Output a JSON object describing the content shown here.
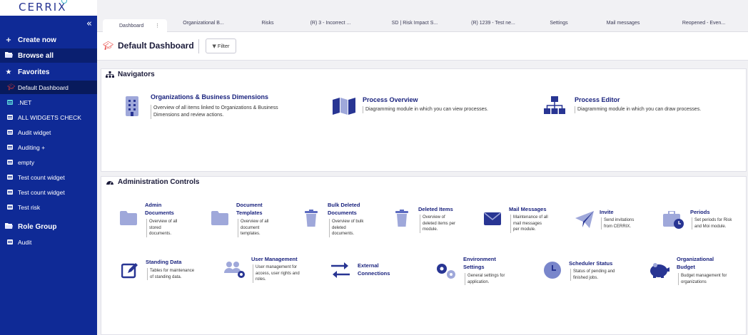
{
  "app": {
    "logo": "CERRIX"
  },
  "sidebar": {
    "collapse_icon": "double-chevron-left-icon",
    "create_now": "Create now",
    "browse_all": "Browse all",
    "favorites": "Favorites",
    "items": [
      {
        "label": "Default Dashboard",
        "icon": "dashboard-icon"
      },
      {
        "label": ".NET",
        "icon": "widget-icon"
      },
      {
        "label": "ALL WIDGETS CHECK",
        "icon": "widget-icon"
      },
      {
        "label": "Audit widget",
        "icon": "widget-icon"
      },
      {
        "label": "Auditing +",
        "icon": "widget-icon"
      },
      {
        "label": "empty",
        "icon": "widget-icon"
      },
      {
        "label": "Test count widget",
        "icon": "widget-icon"
      },
      {
        "label": "Test count widget",
        "icon": "widget-icon"
      },
      {
        "label": "Test risk",
        "icon": "widget-icon"
      }
    ],
    "role_group": "Role Group",
    "role_items": [
      {
        "label": "Audit",
        "icon": "widget-icon"
      }
    ]
  },
  "tabs": [
    {
      "label": "Dashboard"
    },
    {
      "label": "Organizational B..."
    },
    {
      "label": "Risks"
    },
    {
      "label": "(R) 3 - Incorrect ..."
    },
    {
      "label": "SD | Risk Impact S..."
    },
    {
      "label": "(R) 1239 - Test ne..."
    },
    {
      "label": "Settings"
    },
    {
      "label": "Mail messages"
    },
    {
      "label": "Reopened - Even..."
    }
  ],
  "page": {
    "title": "Default Dashboard",
    "filter_label": "Filter"
  },
  "navigators": {
    "title": "Navigators",
    "tiles": [
      {
        "title": "Organizations & Business Dimensions",
        "desc": [
          "Overview of all items linked to Organizations & Business",
          "Dimensions and review actions."
        ],
        "icon": "building-icon"
      },
      {
        "title": "Process Overview",
        "desc": [
          "Diagramming module in which you can view processes."
        ],
        "icon": "map-icon"
      },
      {
        "title": "Process Editor",
        "desc": [
          "Diagramming module in which you can draw processes."
        ],
        "icon": "sitemap-icon"
      }
    ]
  },
  "admin": {
    "title": "Administration Controls",
    "tiles": [
      {
        "title": [
          "Admin",
          "Documents"
        ],
        "desc": [
          "Overview of all",
          "stored",
          "documents."
        ],
        "icon": "folder-icon"
      },
      {
        "title": [
          "Document",
          "Templates"
        ],
        "desc": [
          "Overview of all",
          "document",
          "templates."
        ],
        "icon": "folder-icon"
      },
      {
        "title": [
          "Bulk Deleted",
          "Documents"
        ],
        "desc": [
          "Overview of bulk",
          "deleted",
          "documents."
        ],
        "icon": "trash-icon"
      },
      {
        "title": [
          "Deleted Items"
        ],
        "desc": [
          "Overview of",
          "deleted items per",
          "module."
        ],
        "icon": "trash-icon"
      },
      {
        "title": [
          "Mail Messages"
        ],
        "desc": [
          "Maintenance of all",
          "mail messages",
          "per module."
        ],
        "icon": "envelope-icon"
      },
      {
        "title": [
          "Invite"
        ],
        "desc": [
          "Send invitations",
          "from CERRIX."
        ],
        "icon": "paper-plane-icon"
      },
      {
        "title": [
          "Periods"
        ],
        "desc": [
          "Set periods for Risk",
          "and Moi module."
        ],
        "icon": "briefcase-clock-icon"
      },
      {
        "title": [
          "Standing Data"
        ],
        "desc": [
          "Tables for maintenance",
          "of standing data."
        ],
        "icon": "edit-icon"
      },
      {
        "title": [
          "User Management"
        ],
        "desc": [
          "User management for",
          "access, user rights and",
          "roles."
        ],
        "icon": "users-cog-icon"
      },
      {
        "title": [
          "External",
          "Connections"
        ],
        "desc": [],
        "icon": "exchange-icon"
      },
      {
        "title": [
          "Environment",
          "Settings"
        ],
        "desc": [
          "General settings for",
          "application."
        ],
        "icon": "cogs-icon"
      },
      {
        "title": [
          "Scheduler Status"
        ],
        "desc": [
          "Status of pending and",
          "finished jobs."
        ],
        "icon": "clock-icon"
      },
      {
        "title": [
          "Organizational",
          "Budget"
        ],
        "desc": [
          "Budget management for",
          "organizations"
        ],
        "icon": "piggy-bank-icon"
      }
    ]
  },
  "colors": {
    "sidebar": "#0f2a96",
    "accent": "#1a237e",
    "icon_light": "#9fa8da",
    "icon_dark": "#283593",
    "dashboard_icon": "#e53935"
  }
}
